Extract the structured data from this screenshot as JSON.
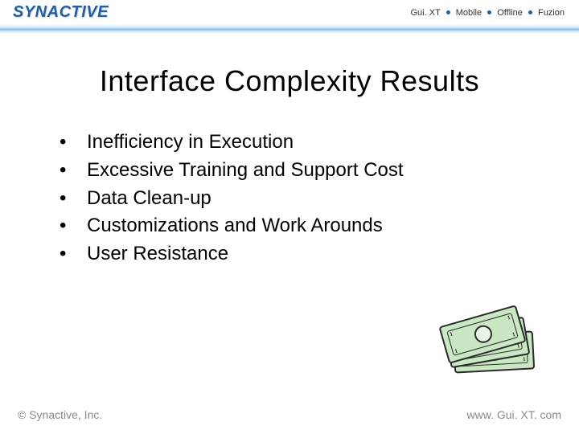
{
  "header": {
    "logo_text": "SYNACTIVE",
    "products": [
      "Gui. XT",
      "Mobile",
      "Offline",
      "Fuzion"
    ]
  },
  "title": "Interface Complexity Results",
  "bullets": [
    "Inefficiency in Execution",
    "Excessive Training and Support Cost",
    "Data Clean-up",
    "Customizations and Work Arounds",
    "User Resistance"
  ],
  "footer": {
    "copyright": "© Synactive, Inc.",
    "url": "www. Gui. XT. com"
  }
}
